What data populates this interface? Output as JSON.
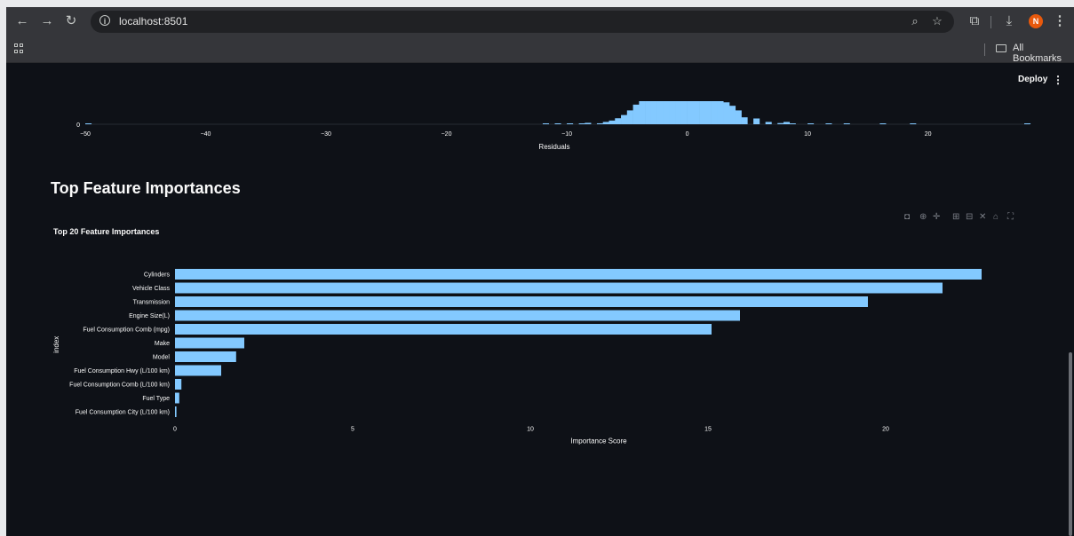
{
  "browser": {
    "url": "localhost:8501",
    "bookmarks_label": "All Bookmarks",
    "avatar_letter": "N",
    "icons": [
      "back-icon",
      "forward-icon",
      "reload-icon",
      "info-icon",
      "zoom-icon",
      "star-icon",
      "extensions-icon",
      "download-icon",
      "menu-icon",
      "apps-icon",
      "folder-icon"
    ]
  },
  "app": {
    "deploy_label": "Deploy",
    "kebab": "⋮",
    "section_title": "Top Feature Importances"
  },
  "colors": {
    "bar": "#83c9ff",
    "background": "#0e1117",
    "text": "#fafafa"
  },
  "chart_data": [
    {
      "type": "bar",
      "orientation": "vertical",
      "title": "",
      "xlabel": "Residuals",
      "ylabel": "",
      "x_ticks": [
        -50,
        -40,
        -30,
        -20,
        -10,
        0,
        10,
        20
      ],
      "y_ticks": [
        0
      ],
      "xlim": [
        -50,
        28
      ],
      "partial_view": true,
      "bins": [
        {
          "x": -50,
          "value": 0.3
        },
        {
          "x": -12,
          "value": 0.15
        },
        {
          "x": -11,
          "value": 0.2
        },
        {
          "x": -10,
          "value": 0.25
        },
        {
          "x": -9,
          "value": 0.3
        },
        {
          "x": -8.5,
          "value": 0.6
        },
        {
          "x": -7.5,
          "value": 0.4
        },
        {
          "x": -7,
          "value": 1.0
        },
        {
          "x": -6.5,
          "value": 1.6
        },
        {
          "x": -6,
          "value": 2.6
        },
        {
          "x": -5.5,
          "value": 4.0
        },
        {
          "x": -5,
          "value": 6.0
        },
        {
          "x": -4.5,
          "value": 8.5
        },
        {
          "x": -4,
          "value": 10
        },
        {
          "x": -3.5,
          "value": 10
        },
        {
          "x": -3,
          "value": 10
        },
        {
          "x": -2.5,
          "value": 10
        },
        {
          "x": -2,
          "value": 10
        },
        {
          "x": -1.5,
          "value": 10
        },
        {
          "x": -1,
          "value": 10
        },
        {
          "x": -0.5,
          "value": 10
        },
        {
          "x": 0,
          "value": 10
        },
        {
          "x": 0.5,
          "value": 10
        },
        {
          "x": 1,
          "value": 10
        },
        {
          "x": 1.5,
          "value": 10
        },
        {
          "x": 2,
          "value": 10
        },
        {
          "x": 2.5,
          "value": 10
        },
        {
          "x": 3,
          "value": 9.5
        },
        {
          "x": 3.5,
          "value": 8.0
        },
        {
          "x": 4,
          "value": 6.0
        },
        {
          "x": 4.5,
          "value": 3.0
        },
        {
          "x": 5.5,
          "value": 2.5
        },
        {
          "x": 6.5,
          "value": 1.0
        },
        {
          "x": 7.5,
          "value": 0.5
        },
        {
          "x": 8,
          "value": 1.0
        },
        {
          "x": 8.5,
          "value": 0.3
        },
        {
          "x": 10,
          "value": 0.2
        },
        {
          "x": 11.5,
          "value": 0.2
        },
        {
          "x": 13,
          "value": 0.2
        },
        {
          "x": 16,
          "value": 0.2
        },
        {
          "x": 18.5,
          "value": 0.2
        },
        {
          "x": 28,
          "value": 0.2
        }
      ]
    },
    {
      "type": "bar",
      "orientation": "horizontal",
      "title": "Top 20 Feature Importances",
      "xlabel": "Importance Score",
      "ylabel": "index",
      "x_ticks": [
        0,
        5,
        10,
        15,
        20
      ],
      "xlim": [
        0,
        23.7
      ],
      "categories": [
        "Cylinders",
        "Vehicle Class",
        "Transmission",
        "Engine Size(L)",
        "Fuel Consumption Comb (mpg)",
        "Make",
        "Model",
        "Fuel Consumption Hwy (L/100 km)",
        "Fuel Consumption Comb (L/100 km)",
        "Fuel Type",
        "Fuel Consumption City (L/100 km)"
      ],
      "values": [
        22.7,
        21.6,
        19.5,
        15.9,
        15.1,
        1.95,
        1.72,
        1.3,
        0.18,
        0.12,
        0.04
      ]
    }
  ]
}
